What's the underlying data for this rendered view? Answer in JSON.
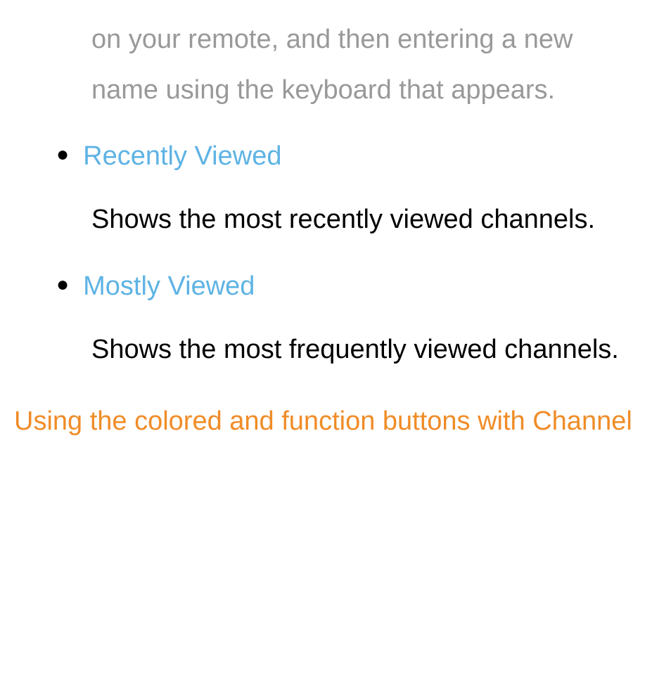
{
  "continuation_text": "on your remote, and then entering a new name using the keyboard that appears.",
  "items": [
    {
      "title": "Recently Viewed",
      "description": "Shows the most recently viewed channels."
    },
    {
      "title": "Mostly Viewed",
      "description": "Shows the most frequently viewed channels."
    }
  ],
  "section_heading": "Using the colored and function buttons with Channel"
}
